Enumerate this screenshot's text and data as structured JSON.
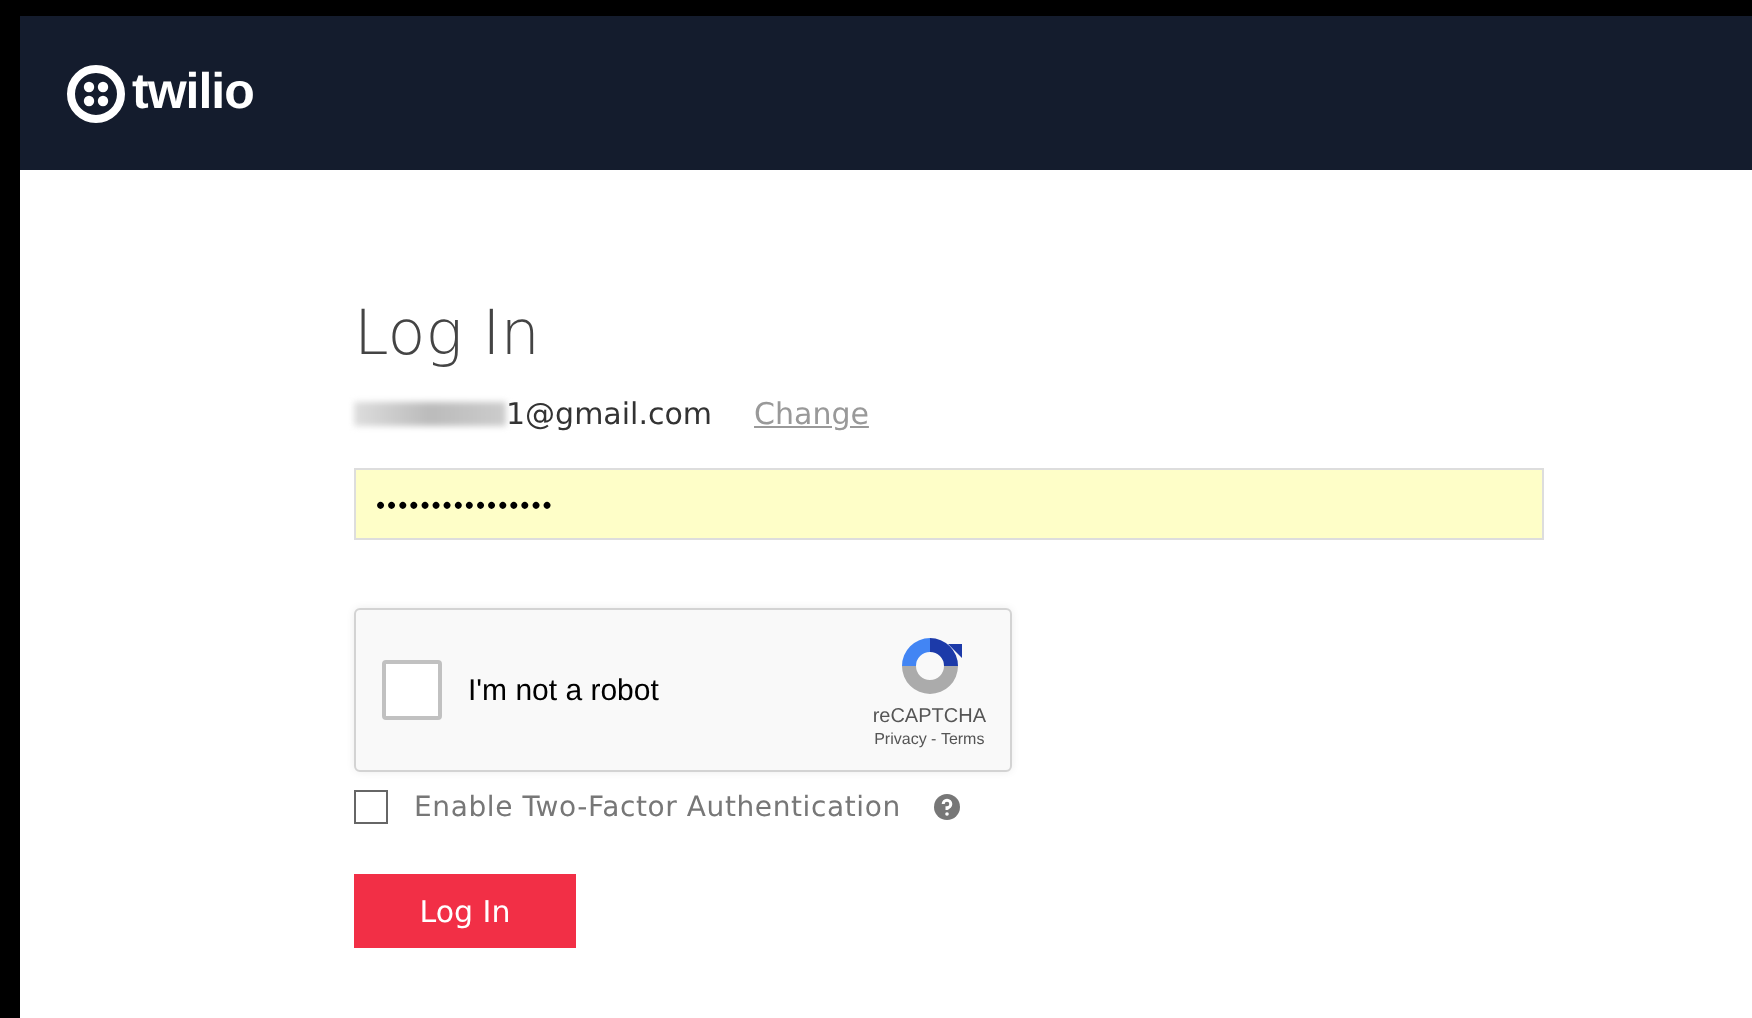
{
  "header": {
    "logo_text": "twilio"
  },
  "title": "Log In",
  "account": {
    "email_visible": "1@gmail.com",
    "redacted": true,
    "change_link": "Change"
  },
  "password": {
    "value": "••••••••••••••••",
    "autofilled": true
  },
  "captcha": {
    "label": "I'm not a robot",
    "checked": false,
    "brand": "reCAPTCHA",
    "privacy": "Privacy",
    "separator": " - ",
    "terms": "Terms"
  },
  "two_factor": {
    "label": "Enable Two-Factor Authentication",
    "checked": false
  },
  "submit": "Log In"
}
